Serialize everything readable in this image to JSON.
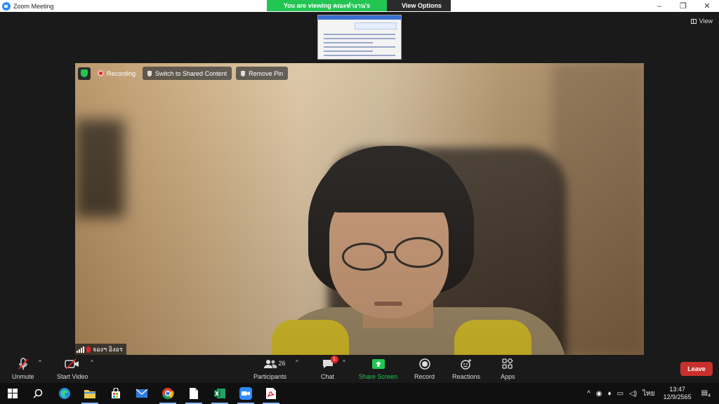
{
  "window": {
    "title": "Zoom Meeting"
  },
  "banner": {
    "viewing_text": "You are viewing คณะทำงาน's screen",
    "view_options_label": "View Options"
  },
  "top": {
    "view_label": "View"
  },
  "video": {
    "recording_label": "Recording",
    "switch_label": "Switch to Shared Content",
    "remove_pin_label": "Remove Pin",
    "participant_name": "จองฯ อิงอร"
  },
  "controls": {
    "unmute_label": "Unmute",
    "start_video_label": "Start Video",
    "participants_label": "Participants",
    "participants_count": "26",
    "chat_label": "Chat",
    "chat_badge": "1",
    "share_screen_label": "Share Screen",
    "record_label": "Record",
    "reactions_label": "Reactions",
    "apps_label": "Apps",
    "leave_label": "Leave"
  },
  "taskbar": {
    "language": "ไทย",
    "time": "13:47",
    "date": "12/9/2565",
    "notification_count": "4"
  },
  "colors": {
    "accent_green": "#23c552",
    "leave_red": "#c9302c",
    "zoom_blue": "#2d8cff"
  }
}
